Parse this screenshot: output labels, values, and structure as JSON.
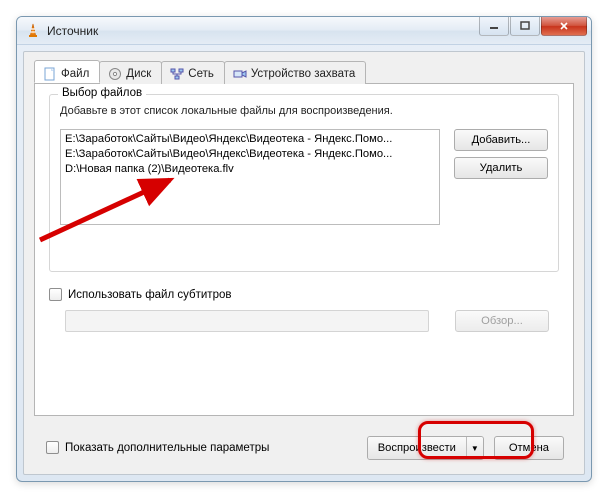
{
  "window_title": "Источник",
  "tabs": {
    "file": "Файл",
    "disc": "Диск",
    "network": "Сеть",
    "capture": "Устройство захвата"
  },
  "group": {
    "label": "Выбор файлов",
    "hint": "Добавьте в этот список локальные файлы для воспроизведения.",
    "add": "Добавить...",
    "remove": "Удалить"
  },
  "files": [
    "E:\\Заработок\\Сайты\\Видео\\Яндекс\\Видеотека - Яндекс.Помо...",
    "E:\\Заработок\\Сайты\\Видео\\Яндекс\\Видеотека - Яндекс.Помо...",
    "D:\\Новая папка (2)\\Видеотека.flv"
  ],
  "subtitles": {
    "use_label": "Использовать файл субтитров",
    "browse": "Обзор..."
  },
  "show_more": "Показать дополнительные параметры",
  "play": "Воспроизвести",
  "cancel": "Отмена"
}
